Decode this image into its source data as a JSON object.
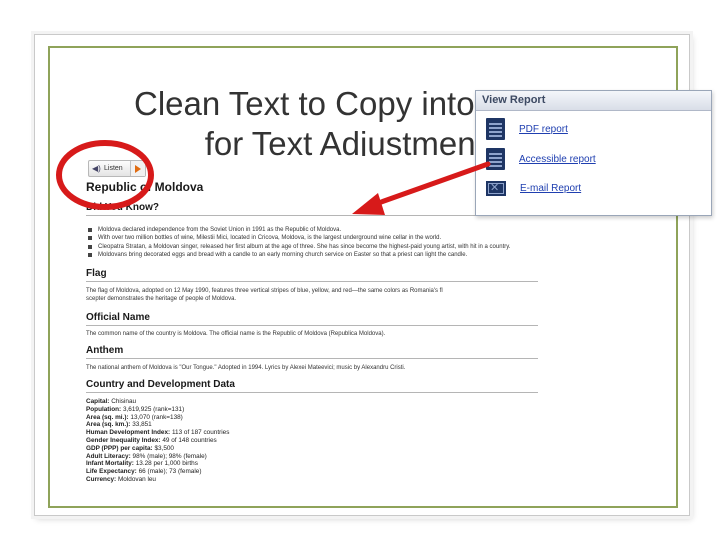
{
  "slide": {
    "title_line1": "Clean Text to Copy into Word",
    "title_line2": "for Text Adjustments"
  },
  "listen_button": {
    "label": "Listen"
  },
  "article": {
    "title": "Republic of Moldova",
    "did_you_know": "Did You Know?",
    "bullets": [
      "Moldova declared independence from the Soviet Union in 1991 as the Republic of Moldova.",
      "With over two million bottles of wine, Milestii Mici, located in Cricova, Moldova, is the largest underground wine cellar in the world.",
      "Cleopatra Stratan, a Moldovan singer, released her first album at the age of three. She has since become the highest-paid young artist, with hit in a country.",
      "Moldovans bring decorated eggs and bread with a candle to an early morning church service on Easter so that a priest can light the candle."
    ],
    "flag_heading": "Flag",
    "flag_text_1": "The flag of Moldova, adopted on 12 May 1990, features three vertical stripes of blue, yellow, and red—the same colors as Romania's fl",
    "flag_text_2": "scepter demonstrates the heritage of people of Moldova.",
    "official_heading": "Official Name",
    "official_text": "The common name of the country is Moldova. The official name is the Republic of Moldova (Republica Moldova).",
    "anthem_heading": "Anthem",
    "anthem_text": "The national anthem of Moldova is \"Our Tongue.\" Adopted in 1994. Lyrics by Alexei Mateevici; music by Alexandru Cristi.",
    "country_heading": "Country and Development Data",
    "facts": [
      {
        "k": "Capital:",
        "v": "Chisinau"
      },
      {
        "k": "Population:",
        "v": "3,619,925 (rank=131)"
      },
      {
        "k": "Area (sq. mi.):",
        "v": "13,070 (rank=138)"
      },
      {
        "k": "Area (sq. km.):",
        "v": "33,851"
      },
      {
        "k": "Human Development Index:",
        "v": "113 of 187 countries"
      },
      {
        "k": "Gender Inequality Index:",
        "v": "49 of 148 countries"
      },
      {
        "k": "GDP (PPP) per capita:",
        "v": "$3,500"
      },
      {
        "k": "Adult Literacy:",
        "v": "98% (male); 98% (female)"
      },
      {
        "k": "Infant Mortality:",
        "v": "13.28 per 1,000 births"
      },
      {
        "k": "Life Expectancy:",
        "v": "66 (male); 73 (female)"
      },
      {
        "k": "Currency:",
        "v": "Moldovan leu"
      }
    ]
  },
  "view_report": {
    "header": "View Report",
    "items": [
      {
        "label": "PDF report",
        "icon": "document-icon"
      },
      {
        "label": "Accessible report",
        "icon": "document-icon"
      },
      {
        "label": "E-mail Report",
        "icon": "email-icon"
      }
    ]
  },
  "colors": {
    "frame_border": "#8fa35a",
    "annotation_red": "#d71a1a",
    "link_blue": "#1f3fb0"
  }
}
